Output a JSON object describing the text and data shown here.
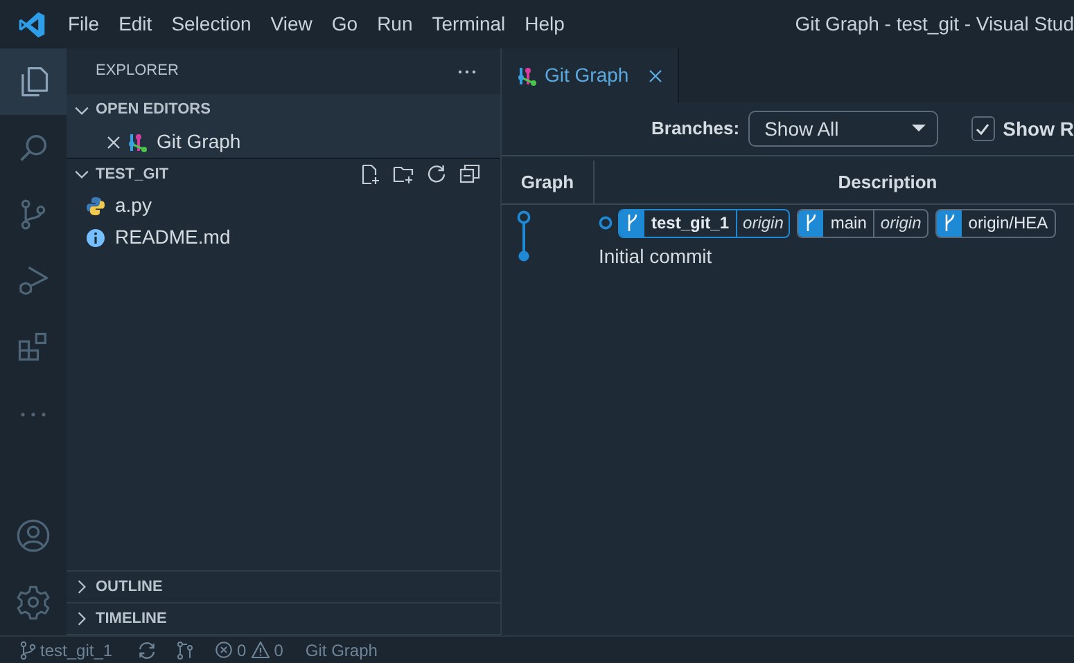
{
  "window": {
    "title": "Git Graph - test_git - Visual Stud"
  },
  "menu": [
    "File",
    "Edit",
    "Selection",
    "View",
    "Go",
    "Run",
    "Terminal",
    "Help"
  ],
  "activity_bar": [
    {
      "kind": "explorer",
      "selected": true
    },
    {
      "kind": "search",
      "selected": false
    },
    {
      "kind": "source-control",
      "selected": false
    },
    {
      "kind": "run-debug",
      "selected": false
    },
    {
      "kind": "extensions",
      "selected": false
    },
    {
      "kind": "more",
      "selected": false
    },
    {
      "kind": "account",
      "selected": false
    },
    {
      "kind": "settings",
      "selected": false
    }
  ],
  "sidebar": {
    "title": "EXPLORER",
    "sections": [
      {
        "title": "OPEN EDITORS",
        "expanded": true,
        "items": [
          {
            "kind": "git-graph",
            "label": "Git Graph",
            "closable": true
          }
        ]
      },
      {
        "title": "TEST_GIT",
        "expanded": true,
        "items": [
          {
            "kind": "python",
            "label": "a.py",
            "closable": false
          },
          {
            "kind": "info",
            "label": "README.md",
            "closable": false
          }
        ]
      },
      {
        "title": "OUTLINE",
        "expanded": false
      },
      {
        "title": "TIMELINE",
        "expanded": false
      }
    ]
  },
  "tabs": [
    {
      "label": "Git Graph",
      "selected": true
    }
  ],
  "controls": {
    "branches_label": "Branches:",
    "branches_value": "Show All",
    "show_remote": {
      "label": "Show R",
      "checked": true
    }
  },
  "table": {
    "columns": [
      "Graph",
      "Description"
    ],
    "rows": [
      {
        "head": true,
        "message": "Initial commit",
        "refs": [
          {
            "name": "test_git_1",
            "remote": "origin",
            "current": true
          },
          {
            "name": "main",
            "remote": "origin",
            "current": false
          },
          {
            "name": "origin/HEA",
            "current": false
          }
        ]
      }
    ]
  },
  "status_bar": {
    "branch": "test_git_1",
    "errors": "0",
    "warnings": "0",
    "extension": "Git Graph"
  }
}
